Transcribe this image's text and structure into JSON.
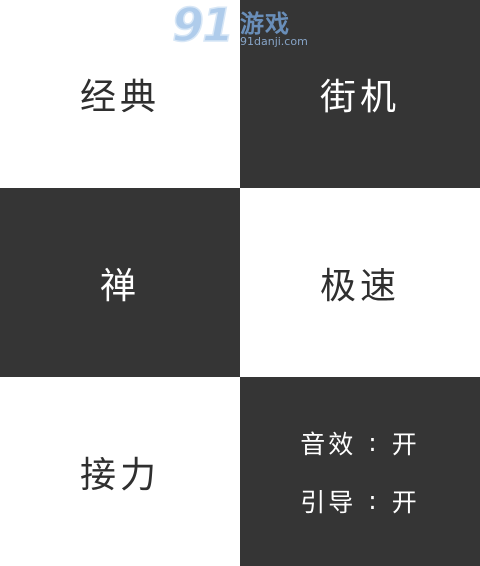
{
  "watermark": {
    "logo_number": "91",
    "logo_text": "游戏",
    "url": "91danji.com"
  },
  "modes": {
    "classic": "经典",
    "arcade": "街机",
    "zen": "禅",
    "rush": "极速",
    "relay": "接力"
  },
  "settings": {
    "sound_label": "音效",
    "sound_value": "开",
    "guide_label": "引导",
    "guide_value": "开",
    "separator": ":"
  },
  "colors": {
    "dark_tile": "#353535",
    "light_tile": "#ffffff",
    "dark_text": "#2f2f2f",
    "light_text": "#ffffff"
  }
}
